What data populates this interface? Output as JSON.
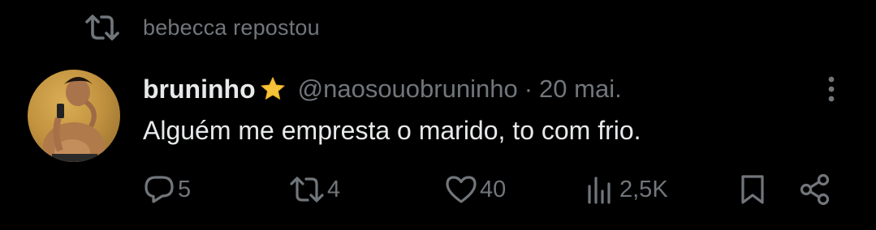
{
  "repost": {
    "text": "bebecca repostou"
  },
  "tweet": {
    "display_name": "bruninho",
    "badge_icon": "star-emoji",
    "handle": "@naosouobruninho",
    "separator": "·",
    "date": "20 mai.",
    "text": "Alguém me empresta o marido, to com frio."
  },
  "actions": {
    "replies": "5",
    "reposts": "4",
    "likes": "40",
    "views": "2,5K"
  },
  "colors": {
    "background": "#000000",
    "primary_text": "#e7e9ea",
    "secondary_text": "#71767b",
    "star": "#f5c23a"
  },
  "icons": [
    "repost-icon",
    "more-options-icon",
    "reply-icon",
    "like-icon",
    "views-icon",
    "bookmark-icon",
    "share-icon"
  ]
}
